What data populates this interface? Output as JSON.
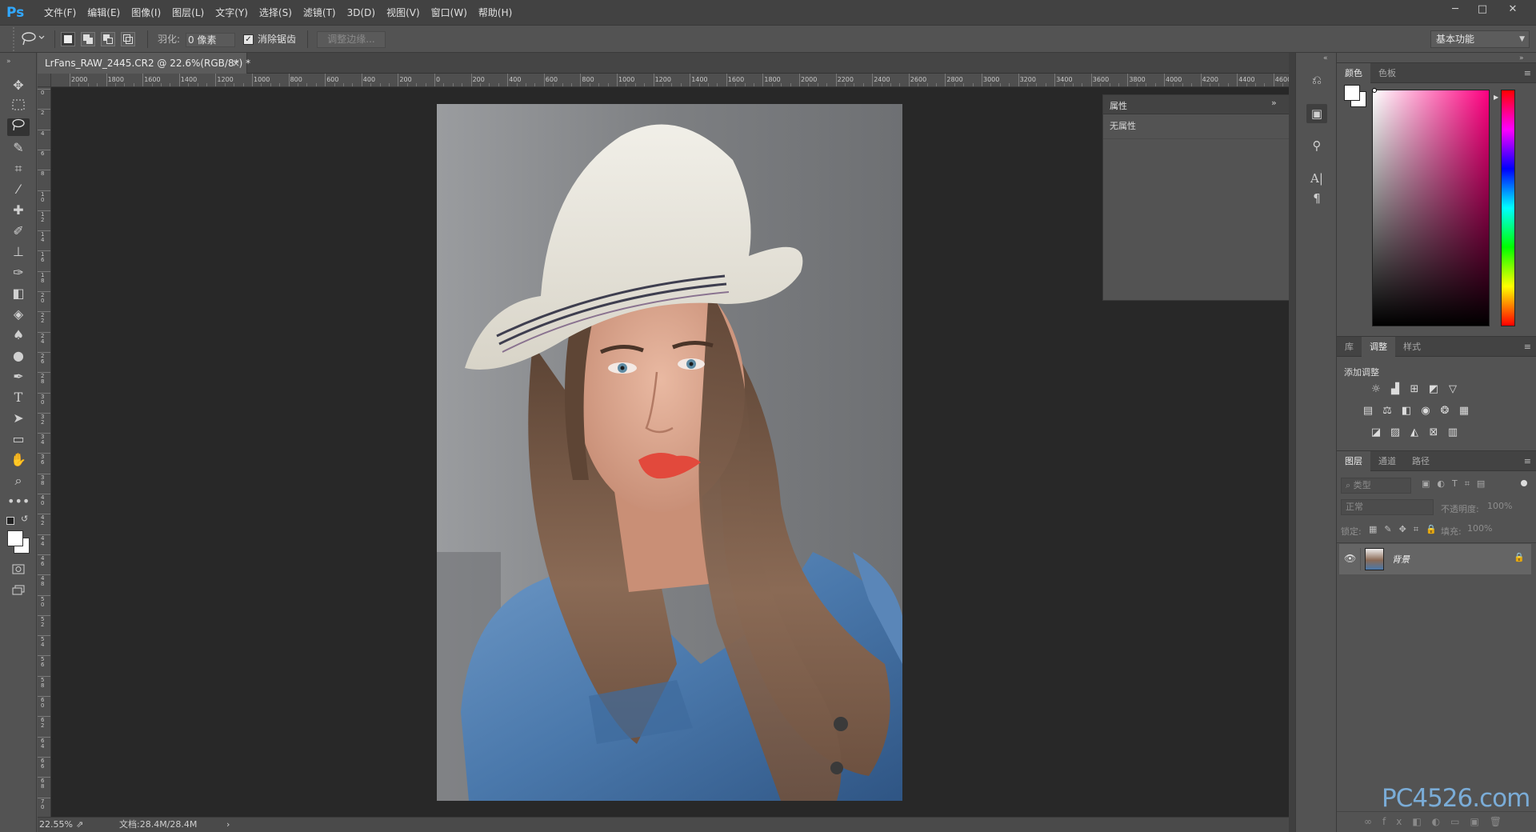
{
  "app": {
    "logo": "Ps"
  },
  "menu": [
    "文件(F)",
    "编辑(E)",
    "图像(I)",
    "图层(L)",
    "文字(Y)",
    "选择(S)",
    "滤镜(T)",
    "3D(D)",
    "视图(V)",
    "窗口(W)",
    "帮助(H)"
  ],
  "window_controls": {
    "minimize": "─",
    "maximize": "□",
    "close": "✕"
  },
  "options": {
    "tool_icon": "lasso-icon",
    "feather_label": "羽化:",
    "feather_value": "0 像素",
    "antialias_label": "消除锯齿",
    "antialias_checked": true,
    "refine_edge": "调整边缘...",
    "workspace": "基本功能"
  },
  "document": {
    "tab_title": "LrFans_RAW_2445.CR2 @ 22.6%(RGB/8*) *",
    "close_glyph": "×",
    "zoom": "22.55%",
    "doc_size": "文档:28.4M/28.4M",
    "ruler_h_labels": [
      "2000",
      "1800",
      "1600",
      "1400",
      "1200",
      "1000",
      "800",
      "600",
      "400",
      "200",
      "0",
      "200",
      "400",
      "600",
      "800",
      "1000",
      "1200",
      "1400",
      "1600",
      "1800",
      "2000",
      "2200",
      "2400",
      "2600",
      "2800",
      "3000",
      "3200",
      "3400",
      "3600",
      "3800",
      "4000",
      "4200",
      "4400",
      "4600"
    ],
    "ruler_v_labels": [
      "0",
      "2",
      "4",
      "6",
      "8",
      "1 0",
      "1 2",
      "1 4",
      "1 6",
      "1 8",
      "2 0",
      "2 2",
      "2 4",
      "2 6",
      "2 8",
      "3 0",
      "3 2",
      "3 4",
      "3 6",
      "3 8",
      "4 0",
      "4 2",
      "4 4",
      "4 6",
      "4 8",
      "5 0",
      "5 2",
      "5 4",
      "5 6",
      "5 8",
      "6 0",
      "6 2",
      "6 4",
      "6 6",
      "6 8",
      "7 0"
    ]
  },
  "properties_panel": {
    "title": "属性",
    "content": "无属性",
    "collapse_glyph": "»",
    "menu_glyph": "≡"
  },
  "color_panel": {
    "tabs": [
      "颜色",
      "色板"
    ],
    "active_tab": 0,
    "foreground": "#ffffff",
    "background": "#ffffff",
    "hue_color": "#ff0080"
  },
  "adjustments_panel": {
    "tabs": [
      "库",
      "调整",
      "样式"
    ],
    "active_tab": 1,
    "add_label": "添加调整",
    "icons_row1": [
      "brightness-icon",
      "levels-icon",
      "curves-icon",
      "exposure-icon",
      "vibrance-icon"
    ],
    "icons_row2": [
      "hue-saturation-icon",
      "color-balance-icon",
      "black-white-icon",
      "photo-filter-icon",
      "channel-mixer-icon",
      "color-lookup-icon"
    ],
    "icons_row3": [
      "invert-icon",
      "posterize-icon",
      "threshold-icon",
      "selective-color-icon",
      "gradient-map-icon"
    ]
  },
  "layers_panel": {
    "tabs": [
      "图层",
      "通道",
      "路径"
    ],
    "active_tab": 0,
    "filter_type": "类型",
    "blend_mode": "正常",
    "opacity_label": "不透明度:",
    "opacity_value": "100%",
    "lock_label": "锁定:",
    "fill_label": "填充:",
    "fill_value": "100%",
    "layers": [
      {
        "name": "背景",
        "visible": true,
        "locked": true
      }
    ]
  },
  "watermark": "PC4526.com"
}
